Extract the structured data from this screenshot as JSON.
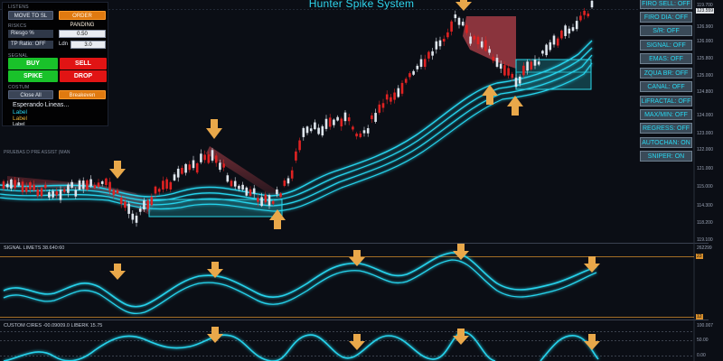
{
  "title": "Hunter Spike System",
  "panel": {
    "section_top": "LISTENS",
    "move_to_sl": "MOVE TO SL",
    "order_panding": "ORDER PANDING",
    "section_risk": "RISKCS",
    "riesgo_label": "Riesgo %",
    "riesgo_value": "0.50",
    "tp_label": "TP Ratio: OFF",
    "ldn_label": "Ldn",
    "ldn_value": "3.0",
    "section_signal": "SEGNAL",
    "buy": "BUY",
    "sell": "SELL",
    "spike": "SPIKE",
    "drop": "DROP",
    "section_close": "COSTUM",
    "close_all": "Close All",
    "breakeven": "Breakeven",
    "status": "Esperando Lineas...",
    "label1": "Label",
    "label2": "Label",
    "label3": "Label",
    "top_strip": "PRUEBAS D PRE ASSIST (MAN"
  },
  "right_buttons": [
    "FIRO SELL: OFF",
    "FIRO DIA: OFF",
    "S/R: OFF",
    "SIGNAL: OFF",
    "EMAS: OFF",
    "ZQUA BR: OFF",
    "CANAL: OFF",
    "LiFRACTAL: OFF",
    "MAX/MIN: OFF",
    "REGRESS: OFF",
    "AUTOCHAN: ON",
    "SNIPER: ON"
  ],
  "price_axis": [
    "119.700",
    "126.900",
    "126.000",
    "125.800",
    "125.000",
    "124.800",
    "124.000",
    "123.000",
    "122.000",
    "121.000",
    "119.800",
    "117.000",
    "116.000",
    "115.000",
    "114.300",
    "118.200",
    "119.100"
  ],
  "current_price": "123.559",
  "sub1": {
    "title": "SIGNAL LIMETS 38.640:60",
    "top_tag": "23",
    "bottom_tag": "12",
    "axis_top": "262299"
  },
  "sub2": {
    "title": "CUSTOM CIRES -00.09009.0 LIBERK 15.75",
    "axis_top": "100.007",
    "axis_mid": "50.00",
    "axis_low": "0.00"
  },
  "colors": {
    "background": "#0b0e15",
    "cyan": "#27d3ec",
    "bull_candle": "#dfe6ee",
    "bear_candle": "#e02222",
    "arrow": "#e9a84a",
    "zone_red": "#c0454f",
    "zone_cyan": "#22b8c8"
  },
  "icons": {
    "arrow_up": "arrow-up-icon",
    "arrow_down": "arrow-down-icon"
  }
}
